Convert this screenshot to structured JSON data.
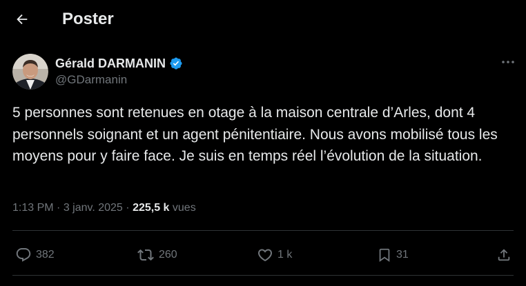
{
  "header": {
    "back_icon": "arrow-left-icon",
    "title": "Poster"
  },
  "tweet": {
    "author": {
      "name": "Gérald DARMANIN",
      "handle": "@GDarmanin",
      "verified": true,
      "verified_color": "#1d9bf0",
      "avatar_icon": "avatar-photo"
    },
    "text": "5 personnes sont retenues en otage à la maison centrale d’Arles, dont 4 personnels soignant et un agent pénitentiaire. Nous avons mobilisé tous les moyens pour y faire face. Je suis en temps réel l’évolution de la situation.",
    "time": "1:13 PM",
    "separator": "·",
    "date": "3 janv. 2025",
    "views_count": "225,5 k",
    "views_label": "vues"
  },
  "actions": {
    "reply_count": "382",
    "repost_count": "260",
    "like_count": "1 k",
    "bookmark_count": "31"
  },
  "colors": {
    "background": "#000000",
    "text_primary": "#e7e9ea",
    "text_secondary": "#71767b",
    "divider": "#2f3336"
  }
}
